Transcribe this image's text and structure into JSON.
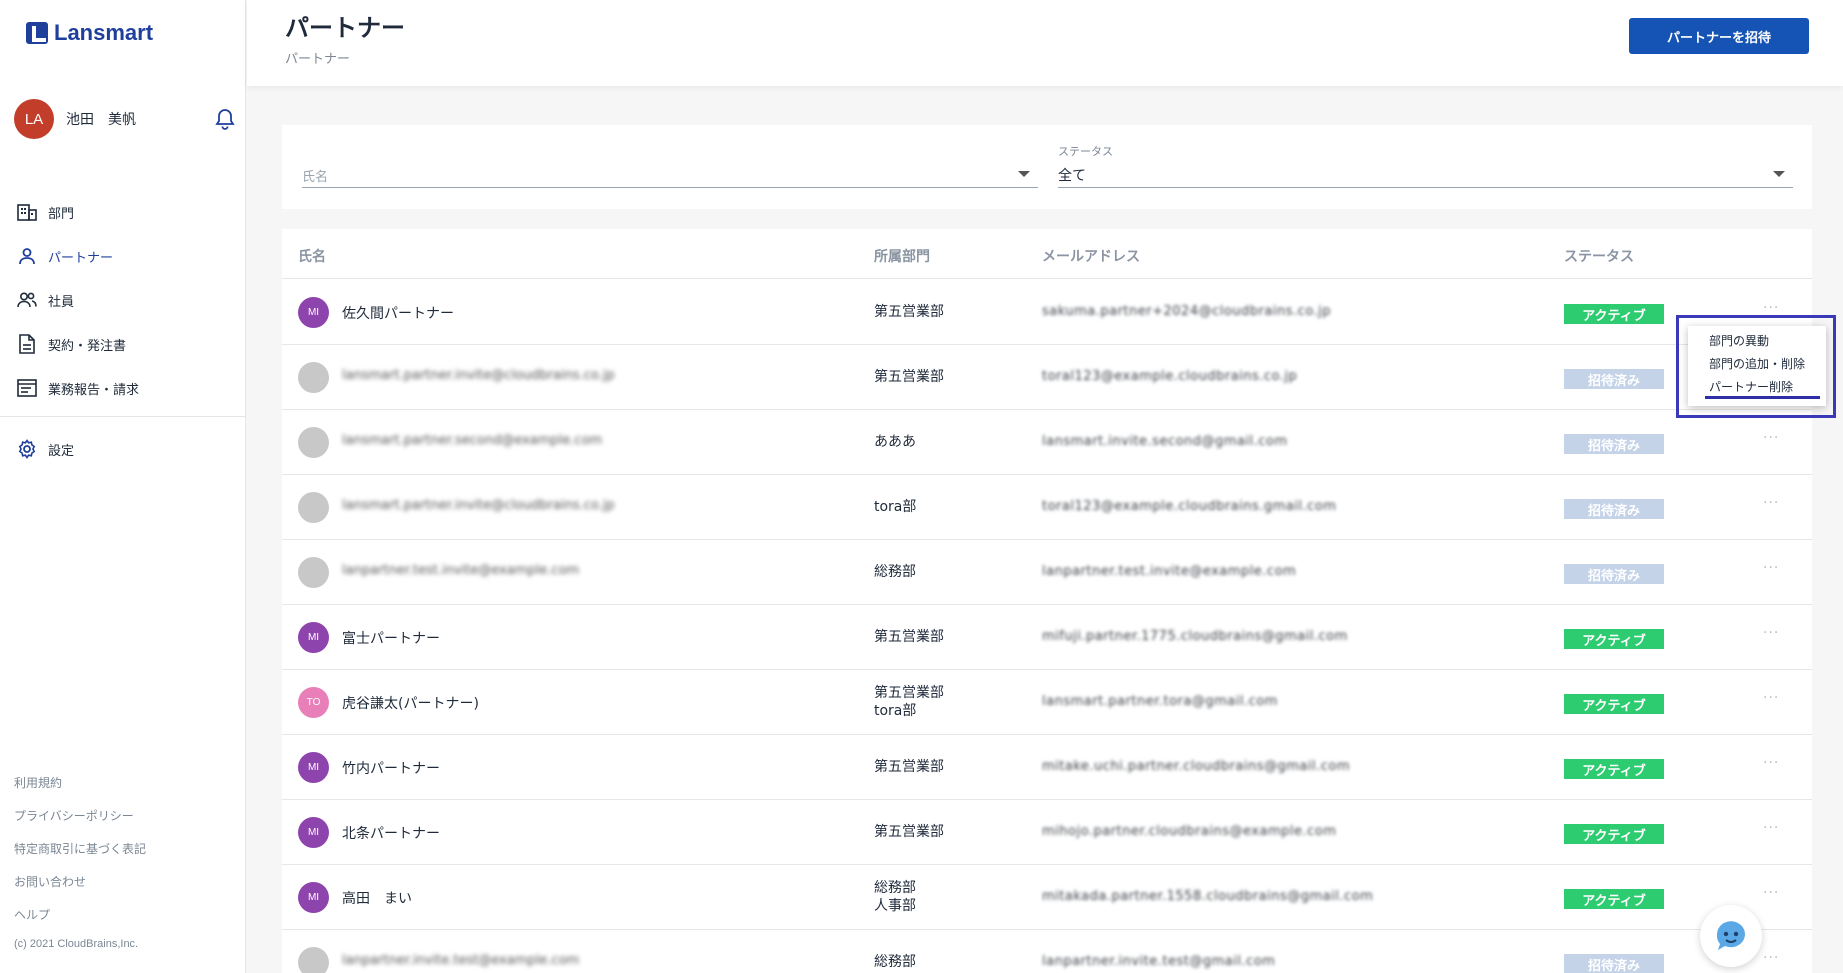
{
  "app": {
    "logo_text": "Lansmart",
    "brand_color": "#1f3f9c",
    "accent_color": "#1554b5"
  },
  "user": {
    "initials": "LA",
    "name": "池田　美帆",
    "avatar_color": "#c33d2b"
  },
  "nav": {
    "items": [
      {
        "label": "部門",
        "icon": "building-icon"
      },
      {
        "label": "パートナー",
        "icon": "person-icon"
      },
      {
        "label": "社員",
        "icon": "people-icon"
      },
      {
        "label": "契約・発注書",
        "icon": "document-icon"
      },
      {
        "label": "業務報告・請求",
        "icon": "report-icon"
      }
    ],
    "settings": {
      "label": "設定",
      "icon": "gear-icon"
    }
  },
  "footer": {
    "links": [
      "利用規約",
      "プライバシーポリシー",
      "特定商取引に基づく表記",
      "お問い合わせ",
      "ヘルプ"
    ],
    "copyright": "(c) 2021 CloudBrains,Inc."
  },
  "header": {
    "title": "パートナー",
    "breadcrumb": "パートナー",
    "invite_button": "パートナーを招待"
  },
  "filters": {
    "name_placeholder": "氏名",
    "status_label": "ステータス",
    "status_value": "全て"
  },
  "table": {
    "columns": {
      "name": "氏名",
      "department": "所属部門",
      "email": "メールアドレス",
      "status": "ステータス"
    },
    "rows": [
      {
        "initials": "MI",
        "avatar_color": "#8e44ad",
        "name": "佐久間パートナー",
        "blurred_name": false,
        "department": [
          "第五営業部"
        ],
        "email": "sakuma.partner+2024@cloudbrains.co.jp",
        "status": "アクティブ"
      },
      {
        "initials": "",
        "avatar_color": "#c8c8c8",
        "name": "lansmart.partner.invite@cloudbrains.co.jp",
        "blurred_name": true,
        "department": [
          "第五営業部"
        ],
        "email": "toral123@example.cloudbrains.co.jp",
        "status": "招待済み"
      },
      {
        "initials": "",
        "avatar_color": "#c8c8c8",
        "name": "lansmart.partner.second@example.com",
        "blurred_name": true,
        "department": [
          "あああ"
        ],
        "email": "lansmart.invite.second@gmail.com",
        "status": "招待済み"
      },
      {
        "initials": "",
        "avatar_color": "#c8c8c8",
        "name": "lansmart.partner.invite@cloudbrains.co.jp",
        "blurred_name": true,
        "department": [
          "tora部"
        ],
        "email": "toral123@example.cloudbrains.gmail.com",
        "status": "招待済み"
      },
      {
        "initials": "",
        "avatar_color": "#c8c8c8",
        "name": "lanpartner.test.invite@example.com",
        "blurred_name": true,
        "department": [
          "総務部"
        ],
        "email": "lanpartner.test.invite@example.com",
        "status": "招待済み"
      },
      {
        "initials": "MI",
        "avatar_color": "#8e44ad",
        "name": "富士パートナー",
        "blurred_name": false,
        "department": [
          "第五営業部"
        ],
        "email": "mifuji.partner.1775.cloudbrains@gmail.com",
        "status": "アクティブ"
      },
      {
        "initials": "TO",
        "avatar_color": "#e87fb8",
        "name": "虎谷謙太(パートナー)",
        "blurred_name": false,
        "department": [
          "第五営業部",
          "tora部"
        ],
        "email": "lansmart.partner.tora@gmail.com",
        "status": "アクティブ"
      },
      {
        "initials": "MI",
        "avatar_color": "#8e44ad",
        "name": "竹内パートナー",
        "blurred_name": false,
        "department": [
          "第五営業部"
        ],
        "email": "mitake.uchi.partner.cloudbrains@gmail.com",
        "status": "アクティブ"
      },
      {
        "initials": "MI",
        "avatar_color": "#8e44ad",
        "name": "北条パートナー",
        "blurred_name": false,
        "department": [
          "第五営業部"
        ],
        "email": "mihojo.partner.cloudbrains@example.com",
        "status": "アクティブ"
      },
      {
        "initials": "MI",
        "avatar_color": "#8e44ad",
        "name": "高田　まい",
        "blurred_name": false,
        "department": [
          "総務部",
          "人事部"
        ],
        "email": "mitakada.partner.1558.cloudbrains@gmail.com",
        "status": "アクティブ"
      },
      {
        "initials": "",
        "avatar_color": "#c8c8c8",
        "name": "lanpartner.invite.test@example.com",
        "blurred_name": true,
        "department": [
          "総務部"
        ],
        "email": "lanpartner.invite.test@gmail.com",
        "status": "招待済み"
      }
    ]
  },
  "status_colors": {
    "アクティブ": "#2ecc71",
    "招待済み": "#c5d3e8"
  },
  "context_menu": {
    "items": [
      "部門の異動",
      "部門の追加・削除",
      "パートナー削除"
    ]
  },
  "more_icon": "···",
  "chatbot_icon": "chatbot-icon"
}
